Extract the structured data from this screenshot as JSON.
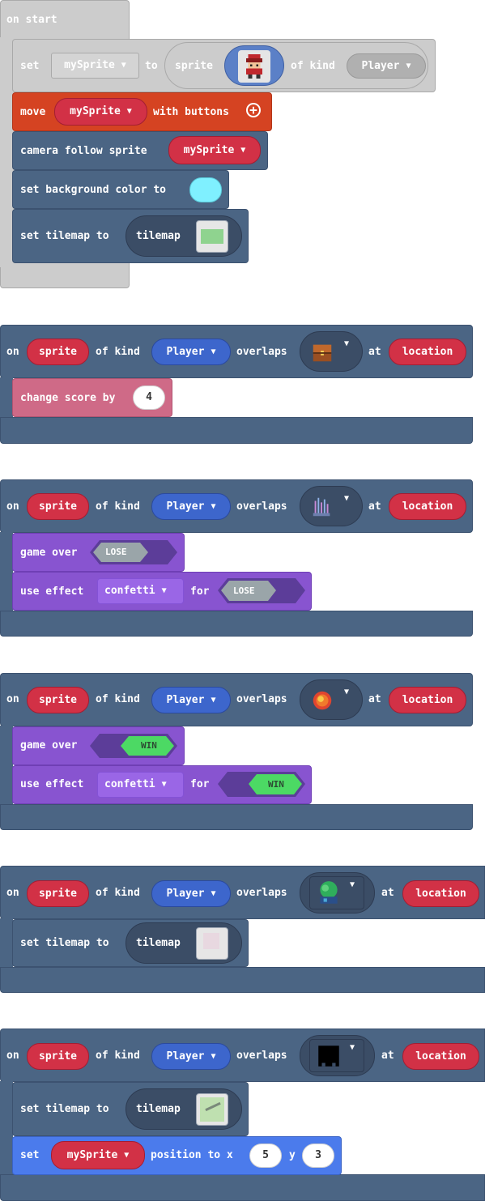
{
  "blocks": {
    "on_start": {
      "label": "on start",
      "set_label": "set",
      "var": "mySprite",
      "to_label": "to",
      "sprite_label": "sprite",
      "of_kind_label": "of kind",
      "kind": "Player",
      "move_label": "move",
      "move_var": "mySprite",
      "with_buttons_label": "with buttons",
      "camera_label": "camera follow sprite",
      "camera_var": "mySprite",
      "bg_label": "set background color to",
      "bg_color": "#7ff0ff",
      "tilemap_label": "set tilemap to",
      "tilemap_word": "tilemap"
    },
    "overlap1": {
      "on": "on",
      "sprite": "sprite",
      "of_kind": "of kind",
      "kind": "Player",
      "overlaps": "overlaps",
      "at": "at",
      "location": "location",
      "change_label": "change score by",
      "score": "4"
    },
    "overlap2": {
      "on": "on",
      "sprite": "sprite",
      "of_kind": "of kind",
      "kind": "Player",
      "overlaps": "overlaps",
      "at": "at",
      "location": "location",
      "game_over": "game over",
      "lose": "LOSE",
      "use_effect": "use effect",
      "effect": "confetti",
      "for": "for",
      "lose2": "LOSE"
    },
    "overlap3": {
      "on": "on",
      "sprite": "sprite",
      "of_kind": "of kind",
      "kind": "Player",
      "overlaps": "overlaps",
      "at": "at",
      "location": "location",
      "game_over": "game over",
      "win": "WIN",
      "use_effect": "use effect",
      "effect": "confetti",
      "for": "for",
      "win2": "WIN"
    },
    "overlap4": {
      "on": "on",
      "sprite": "sprite",
      "of_kind": "of kind",
      "kind": "Player",
      "overlaps": "overlaps",
      "at": "at",
      "location": "location",
      "tilemap_label": "set tilemap to",
      "tilemap_word": "tilemap"
    },
    "overlap5": {
      "on": "on",
      "sprite": "sprite",
      "of_kind": "of kind",
      "kind": "Player",
      "overlaps": "overlaps",
      "at": "at",
      "location": "location",
      "tilemap_label": "set tilemap to",
      "tilemap_word": "tilemap",
      "set_label": "set",
      "var": "mySprite",
      "position_label": "position to x",
      "x": "5",
      "y_label": "y",
      "y": "3"
    }
  },
  "colors": {
    "event": "#4b6584",
    "event_border": "#3c5270",
    "on_start": "#cccccc",
    "on_start_border": "#aaaaaa",
    "controller": "#d54322",
    "info": "#cf6a87",
    "game": "#8854d0",
    "sprites": "#4b7bec",
    "red_pill": "#d23146",
    "blue_pill": "#3d66cc"
  }
}
